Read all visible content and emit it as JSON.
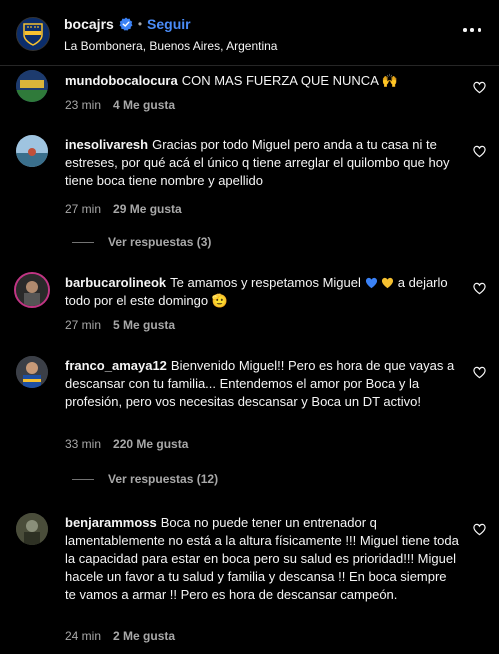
{
  "header": {
    "username": "bocajrs",
    "follow_label": "Seguir",
    "separator": "•",
    "location": "La Bombonera, Buenos Aires, Argentina"
  },
  "comments": [
    {
      "user": "mundobocalocura",
      "text": "CON MAS FUERZA QUE NUNCA 🙌",
      "time": "23 min",
      "likes": "4 Me gusta"
    },
    {
      "user": "inesolivaresh",
      "text": "Gracias por todo Miguel pero anda a tu casa ni te estreses, por qué acá el único q tiene arreglar el quilombo que hoy tiene boca tiene nombre y apellido",
      "time": "27 min",
      "likes": "29 Me gusta",
      "replies": "Ver respuestas (3)"
    },
    {
      "user": "barbucarolineok",
      "text_a": "Te amamos y respetamos Miguel",
      "text_b": "a dejarlo todo por el este domingo",
      "emoji_end": "🫡",
      "time": "27 min",
      "likes": "5 Me gusta"
    },
    {
      "user": "franco_amaya12",
      "text": "Bienvenido Miguel!! Pero es hora de que vayas a descansar con tu familia... Entendemos el amor por Boca y la profesión, pero vos necesitas descansar y Boca un DT activo!",
      "time": "33 min",
      "likes": "220 Me gusta",
      "replies": "Ver respuestas (12)"
    },
    {
      "user": "benjarammoss",
      "text": "Boca no puede tener un entrenador q lamentablemente no está a la altura físicamente !!! Miguel tiene toda la capacidad para estar en boca pero su salud es prioridad!!! Miguel hacele un favor a tu salud y familia y descansa !! En boca siempre te vamos a armar !! Pero es hora de descansar campeón.",
      "time": "24 min",
      "likes": "2 Me gusta"
    }
  ],
  "colors": {
    "background": "#000000",
    "text": "#f5f5f5",
    "muted": "#a8a8a8",
    "link_blue": "#4a8cf7",
    "heart_blue": "#3b82f6",
    "heart_yellow": "#f5c030"
  }
}
